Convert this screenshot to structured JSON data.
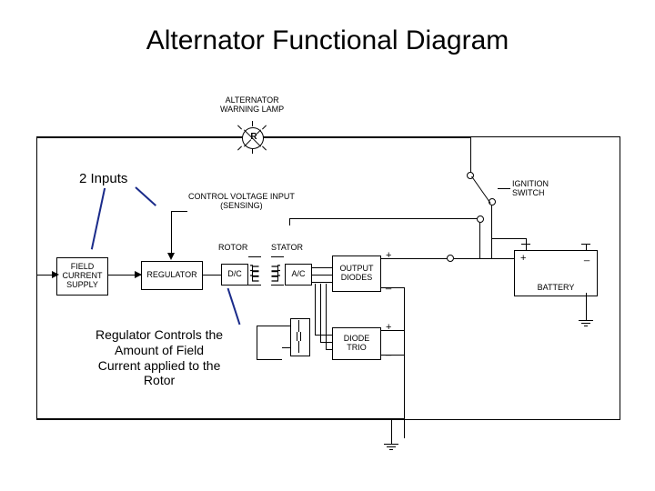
{
  "title": "Alternator Functional Diagram",
  "annotations": {
    "inputs": "2 Inputs",
    "regulator_note_l1": "Regulator Controls the",
    "regulator_note_l2": "Amount of Field",
    "regulator_note_l3": "Current applied to the",
    "regulator_note_l4": "Rotor"
  },
  "labels": {
    "warning_lamp_l1": "ALTERNATOR",
    "warning_lamp_l2": "WARNING LAMP",
    "lamp_letter": "R",
    "control_voltage_l1": "CONTROL VOLTAGE INPUT",
    "control_voltage_l2": "(SENSING)",
    "rotor": "ROTOR",
    "stator": "STATOR",
    "dc": "D/C",
    "ac": "A/C",
    "field_supply_l1": "FIELD",
    "field_supply_l2": "CURRENT",
    "field_supply_l3": "SUPPLY",
    "regulator": "REGULATOR",
    "output_diodes_l1": "OUTPUT",
    "output_diodes_l2": "DIODES",
    "diode_trio_l1": "DIODE",
    "diode_trio_l2": "TRIO",
    "battery": "BATTERY",
    "ignition_l1": "IGNITION",
    "ignition_l2": "SWITCH",
    "plus": "+",
    "minus": "_"
  }
}
